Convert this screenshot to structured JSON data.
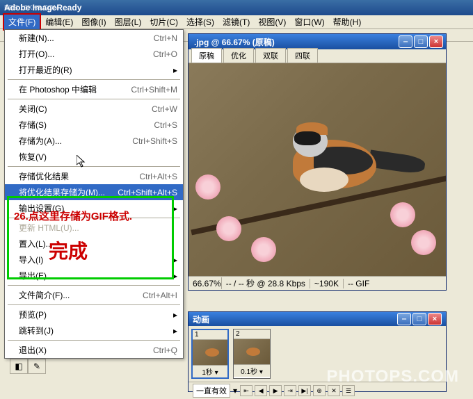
{
  "titlebar": {
    "title": "Adobe ImageReady"
  },
  "menubar": {
    "items": [
      {
        "label": "文件(F)",
        "active": true
      },
      {
        "label": "编辑(E)"
      },
      {
        "label": "图像(I)"
      },
      {
        "label": "图层(L)"
      },
      {
        "label": "切片(C)"
      },
      {
        "label": "选择(S)"
      },
      {
        "label": "滤镜(T)"
      },
      {
        "label": "视图(V)"
      },
      {
        "label": "窗口(W)"
      },
      {
        "label": "帮助(H)"
      }
    ]
  },
  "file_menu": [
    {
      "type": "item",
      "label": "新建(N)...",
      "shortcut": "Ctrl+N"
    },
    {
      "type": "item",
      "label": "打开(O)...",
      "shortcut": "Ctrl+O"
    },
    {
      "type": "item",
      "label": "打开最近的(R)",
      "shortcut": "",
      "arrow": true
    },
    {
      "type": "sep"
    },
    {
      "type": "item",
      "label": "在 Photoshop 中编辑",
      "shortcut": "Ctrl+Shift+M"
    },
    {
      "type": "sep"
    },
    {
      "type": "item",
      "label": "关闭(C)",
      "shortcut": "Ctrl+W"
    },
    {
      "type": "item",
      "label": "存储(S)",
      "shortcut": "Ctrl+S"
    },
    {
      "type": "item",
      "label": "存储为(A)...",
      "shortcut": "Ctrl+Shift+S"
    },
    {
      "type": "item",
      "label": "恢复(V)",
      "shortcut": ""
    },
    {
      "type": "sep"
    },
    {
      "type": "item",
      "label": "存储优化结果",
      "shortcut": "Ctrl+Alt+S"
    },
    {
      "type": "item",
      "label": "将优化结果存储为(M)...",
      "shortcut": "Ctrl+Shift+Alt+S",
      "highlighted": true
    },
    {
      "type": "item",
      "label": "输出设置(G)",
      "shortcut": "",
      "arrow": true
    },
    {
      "type": "sep"
    },
    {
      "type": "item",
      "label": "更新 HTML(U)...",
      "shortcut": "",
      "disabled": true
    },
    {
      "type": "item",
      "label": "置入(L)...",
      "shortcut": ""
    },
    {
      "type": "item",
      "label": "导入(I)",
      "shortcut": "",
      "arrow": true
    },
    {
      "type": "item",
      "label": "导出(E)",
      "shortcut": "",
      "arrow": true
    },
    {
      "type": "sep"
    },
    {
      "type": "item",
      "label": "文件简介(F)...",
      "shortcut": "Ctrl+Alt+I"
    },
    {
      "type": "sep"
    },
    {
      "type": "item",
      "label": "预览(P)",
      "shortcut": "",
      "arrow": true
    },
    {
      "type": "item",
      "label": "跳转到(J)",
      "shortcut": "",
      "arrow": true
    },
    {
      "type": "sep"
    },
    {
      "type": "item",
      "label": "退出(X)",
      "shortcut": "Ctrl+Q"
    }
  ],
  "annotations": {
    "line1": "26.点这里存储为GIF格式.",
    "line2": "完成"
  },
  "document": {
    "title": ".jpg @ 66.67% (原稿)",
    "tabs": [
      "原稿",
      "优化",
      "双联",
      "四联"
    ],
    "status": {
      "zoom": "66.67%",
      "rate": "-- / -- 秒 @ 28.8 Kbps",
      "size": "~190K",
      "format": "-- GIF"
    }
  },
  "animation": {
    "title": "动画",
    "frames": [
      {
        "num": "1",
        "delay": "1秒"
      },
      {
        "num": "2",
        "delay": "0.1秒"
      }
    ],
    "loop": "一直有效",
    "controls": [
      "⇤",
      "◀",
      "▶",
      "⇥",
      "▶|",
      "⊕",
      "✕",
      "☰"
    ]
  },
  "watermarks": {
    "main": "PHOTOPS.COM",
    "corner": "BBS.16XX8.COM"
  }
}
